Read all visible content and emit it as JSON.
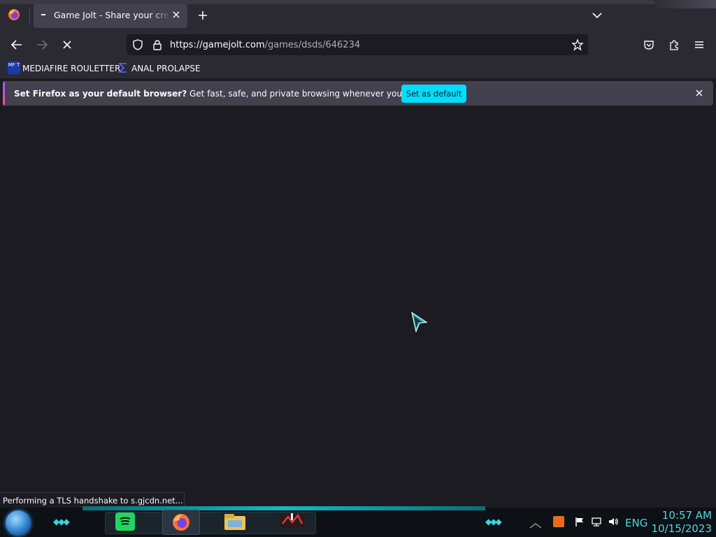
{
  "browser": {
    "tab_title": "Game Jolt - Share your creations",
    "url_host": "https://gamejolt.com",
    "url_path": "/games/dsds/646234"
  },
  "bookmarks": [
    {
      "label": "MEDIAFIRE ROULETTER",
      "icon": "mediafire-icon",
      "icon_text": "MF T"
    },
    {
      "label": "ANAL PROLAPSE",
      "icon": "sigma-bookmark-icon"
    }
  ],
  "notification": {
    "bold": "Set Firefox as your default browser?",
    "text": " Get fast, safe, and private browsing whenever you use the web.",
    "button": "Set as default"
  },
  "status_text": "Performing a TLS handshake to s.gjcdn.net...",
  "taskbar": {
    "apps": [
      "spotify-icon",
      "firefox-icon",
      "file-explorer-icon",
      "game-app-icon"
    ],
    "language": "ENG",
    "time": "10:57 AM",
    "date": "10/15/2023"
  },
  "colors": {
    "accent": "#00ddff",
    "toolbar": "#2b2a33",
    "content": "#1c1b22",
    "taskbar_accent": "#4fd8e6"
  }
}
